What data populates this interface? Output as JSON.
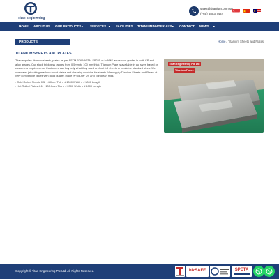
{
  "brand": {
    "name": "Titan Engineering"
  },
  "contact": {
    "email": "sales@titanium.com.sg",
    "phone": "(+65) 6853 7424"
  },
  "nav": {
    "items": [
      "HOME",
      "ABOUT US",
      "OUR PRODUCTS",
      "SERVICES",
      "FACILITIES",
      "TITANIUM MATERIALS",
      "CONTACT",
      "NEWS"
    ]
  },
  "section": {
    "label": "PRODUCTS"
  },
  "breadcrumb": {
    "home": "Home",
    "separator": " / ",
    "current": "Titanium Sheets and Plates"
  },
  "content": {
    "title": "TITANIUM SHEETS AND PLATES",
    "body": "Titan supplies titanium sheets, plates as per ASTM B265/ASTM SB265 or in AMS aerospace grades in both CP and alloy grades. Our stock thickness ranges from 0.5mm to 100 mm thick. Titanium Plate is available in cut sizes based on customers requirements. Customers can buy only what they need and not full sheets or available standard sizes. We use water-jet cutting machine to cut plates and shearing machine for sheets. We supply Titanium Sheets and Plates at very competitive prices with good quality, made by top-tier US and European mills.",
    "specs": [
      "› Cold Rolled Sheets 0.5 ~ 4.0mm Thk x ≤ 1000 Width x ≤ 3000 Length",
      "› Hot Rolled Plates 4.1 ~ 100.0mm Thk x ≤ 2000 Width x ≤ 4000 Length"
    ]
  },
  "photo": {
    "label_company": "Titan Engineering Pte Ltd",
    "label_product": "Titanium Plates"
  },
  "footer": {
    "copyright": "Copyright © Titan Engineering Pte Ltd. All Rights Reserved.",
    "badges": [
      "bizSAFE",
      "SPETA"
    ]
  },
  "colors": {
    "nav": "#1f3f78",
    "brand": "#1d3a6b",
    "whatsapp": "#25d366",
    "label_red": "#c52b2b"
  },
  "icons": [
    "phone-icon",
    "flag-sg-icon",
    "flag-cn-icon",
    "flag-my-icon",
    "whatsapp-icon",
    "chevron-down-icon"
  ]
}
